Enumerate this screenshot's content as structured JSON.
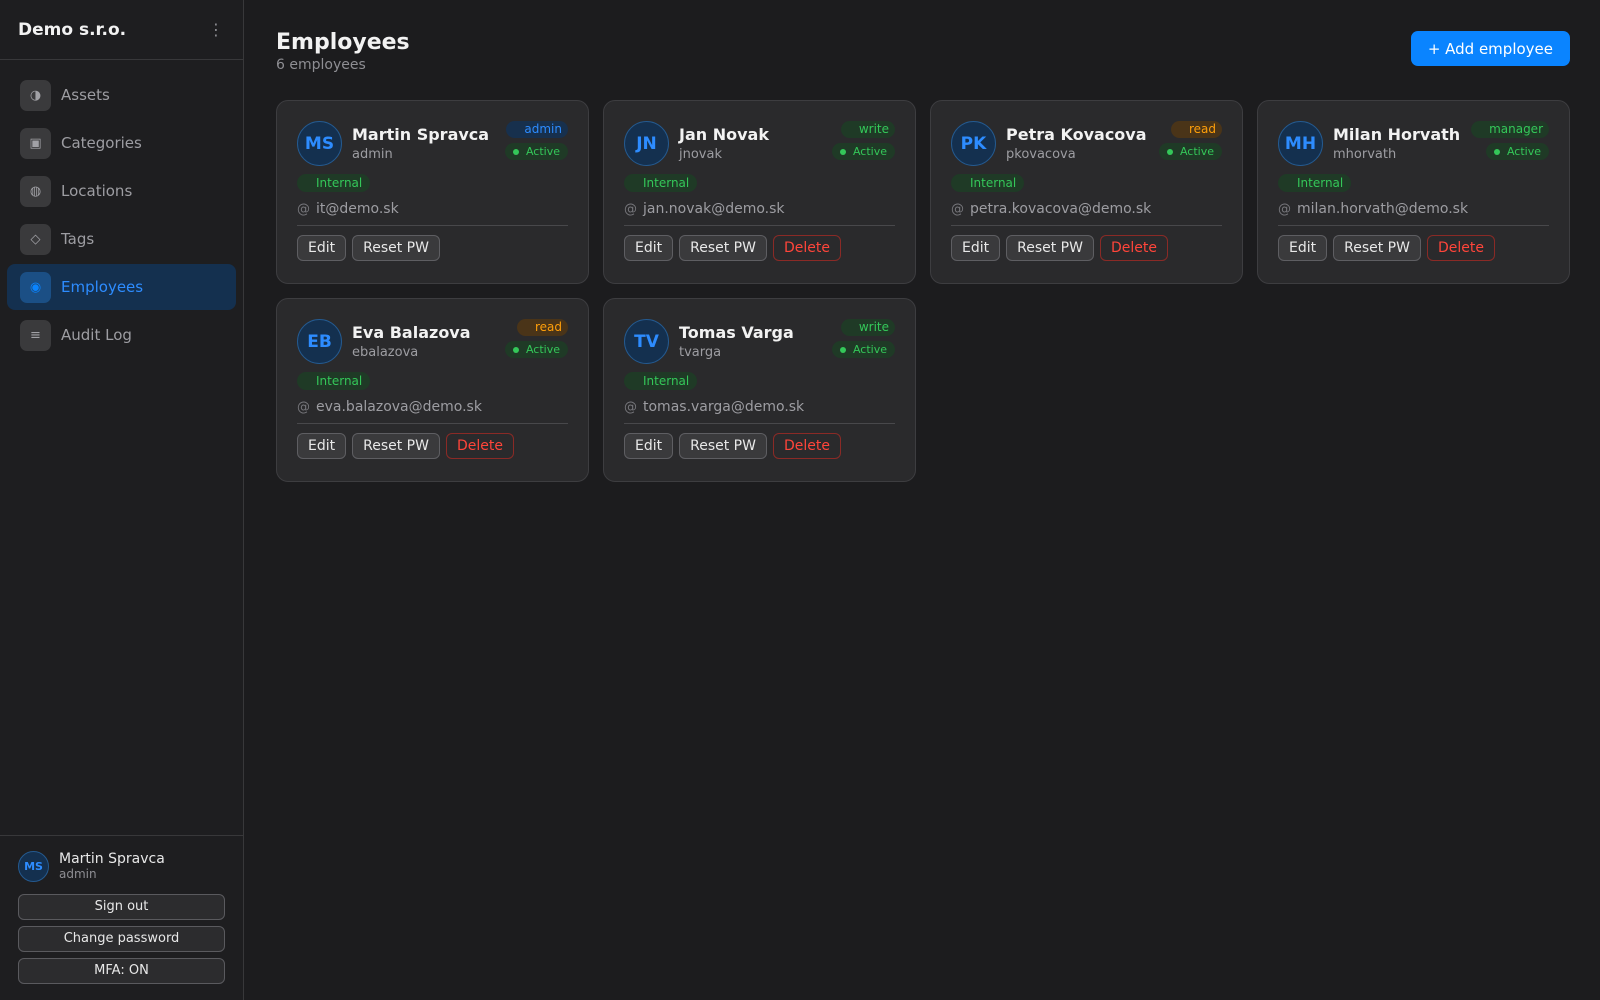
{
  "sidebar": {
    "org_name": "Demo s.r.o.",
    "menu_glyph": "⋮",
    "items": [
      {
        "label": "Assets",
        "icon": "◑",
        "icon_name": "assets-icon",
        "active": false
      },
      {
        "label": "Categories",
        "icon": "▣",
        "icon_name": "categories-icon",
        "active": false
      },
      {
        "label": "Locations",
        "icon": "◍",
        "icon_name": "locations-icon",
        "active": false
      },
      {
        "label": "Tags",
        "icon": "◇",
        "icon_name": "tags-icon",
        "active": false
      },
      {
        "label": "Employees",
        "icon": "◉",
        "icon_name": "employees-icon",
        "active": true
      },
      {
        "label": "Audit Log",
        "icon": "≡",
        "icon_name": "audit-log-icon",
        "active": false
      }
    ],
    "user": {
      "initials": "MS",
      "name": "Martin Spravca",
      "role": "admin"
    },
    "sign_out_label": "Sign out",
    "change_password_label": "Change password",
    "mfa_label": "MFA: ON"
  },
  "header": {
    "title": "Employees",
    "count": "6 employees",
    "add_label": "+ Add employee"
  },
  "labels": {
    "email_glyph": "@",
    "edit": "Edit",
    "reset": "Reset PW",
    "delete": "Delete"
  },
  "employees": [
    {
      "initials": "MS",
      "name": "Martin Spravca",
      "username": "admin",
      "role": "admin",
      "status": "Active",
      "type": "Internal",
      "email": "it@demo.sk",
      "can_delete": false
    },
    {
      "initials": "JN",
      "name": "Jan Novak",
      "username": "jnovak",
      "role": "write",
      "status": "Active",
      "type": "Internal",
      "email": "jan.novak@demo.sk",
      "can_delete": true
    },
    {
      "initials": "PK",
      "name": "Petra Kovacova",
      "username": "pkovacova",
      "role": "read",
      "status": "Active",
      "type": "Internal",
      "email": "petra.kovacova@demo.sk",
      "can_delete": true
    },
    {
      "initials": "MH",
      "name": "Milan Horvath",
      "username": "mhorvath",
      "role": "manager",
      "status": "Active",
      "type": "Internal",
      "email": "milan.horvath@demo.sk",
      "can_delete": true
    },
    {
      "initials": "EB",
      "name": "Eva Balazova",
      "username": "ebalazova",
      "role": "read",
      "status": "Active",
      "type": "Internal",
      "email": "eva.balazova@demo.sk",
      "can_delete": true
    },
    {
      "initials": "TV",
      "name": "Tomas Varga",
      "username": "tvarga",
      "role": "write",
      "status": "Active",
      "type": "Internal",
      "email": "tomas.varga@demo.sk",
      "can_delete": true
    }
  ],
  "colors": {
    "accent": "#0a84ff",
    "success": "#34c759",
    "warning": "#ff9f0a",
    "danger": "#ff453a"
  }
}
